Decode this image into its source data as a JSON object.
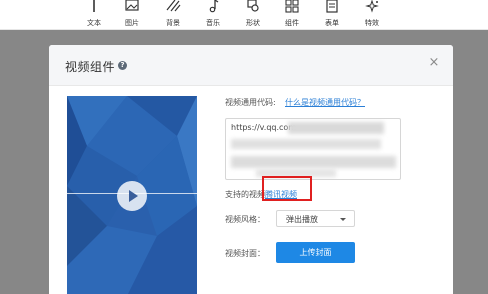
{
  "toolbar": {
    "items": [
      {
        "label": "文本",
        "icon": "text-icon"
      },
      {
        "label": "图片",
        "icon": "image-icon"
      },
      {
        "label": "背景",
        "icon": "background-icon"
      },
      {
        "label": "音乐",
        "icon": "music-icon"
      },
      {
        "label": "形状",
        "icon": "shape-icon"
      },
      {
        "label": "组件",
        "icon": "component-icon"
      },
      {
        "label": "表单",
        "icon": "form-icon"
      },
      {
        "label": "特效",
        "icon": "effects-icon"
      }
    ]
  },
  "dialog": {
    "title": "视频组件",
    "help_glyph": "?",
    "close_glyph": "×",
    "code_label": "视频通用代码:",
    "code_help_link": "什么是视频通用代码？",
    "code_value": "https://v.qq.com",
    "supported_label": "支持的视频",
    "supported_link": "腾讯视频",
    "style_label": "视频风格：",
    "style_value": "弹出播放",
    "cover_label": "视频封面：",
    "upload_button": "上传封面"
  },
  "colors": {
    "overlay": "#878787",
    "preview_blue": "#2a60ad",
    "accent": "#1e88e5",
    "highlight": "#e02020"
  }
}
